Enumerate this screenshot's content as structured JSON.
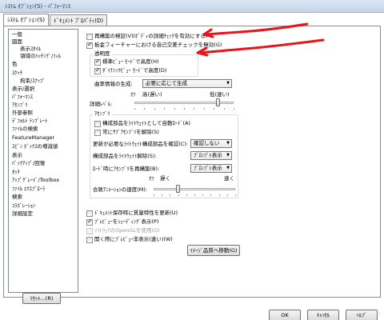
{
  "window": {
    "title": "ｼｽﾃﾑ ｵﾌﾟｼｮﾝ(S) - ﾊﾟﾌｫｰﾏﾝｽ"
  },
  "tabs": [
    {
      "label": "ｼｽﾃﾑ ｵﾌﾟｼｮﾝ(S)"
    },
    {
      "label": "ﾄﾞｷｭﾒﾝﾄ ﾌﾟﾛﾊﾟﾃｨ(D)"
    }
  ],
  "tree": [
    {
      "label": "一般"
    },
    {
      "label": "図面"
    },
    {
      "label": "表示ｽﾀｲﾙ"
    },
    {
      "label": "領域のﾊｯﾁﾝｸﾞ/ﾌｨﾙ"
    },
    {
      "label": "色"
    },
    {
      "label": "ｽｹｯﾁ"
    },
    {
      "label": "拘束/ｽﾅｯﾌﾟ"
    },
    {
      "label": "表示/選択"
    },
    {
      "label": "ﾊﾟﾌｫｰﾏﾝｽ"
    },
    {
      "label": "ｱｾﾝﾌﾞﾘ"
    },
    {
      "label": "外部参照"
    },
    {
      "label": "ﾃﾞﾌｫﾙﾄ ﾃﾝﾌﾟﾚｰﾄ"
    },
    {
      "label": "ﾌｧｲﾙの検索"
    },
    {
      "label": "FeatureManager"
    },
    {
      "label": "ｽﾋﾟﾝ ﾎﾞｯｸｽの増減値"
    },
    {
      "label": "表示"
    },
    {
      "label": "ﾊﾞｯｸｱｯﾌﾟ/回復"
    },
    {
      "label": "ﾀｯﾁ"
    },
    {
      "label": "ｱｯﾌﾟｸﾞﾚｰﾄﾞ/Toolbox"
    },
    {
      "label": "ﾌｧｲﾙ ｴｸｽﾌﾟﾛｰﾗ"
    },
    {
      "label": "検索"
    },
    {
      "label": "ｺﾗﾎﾞﾚｰｼｮﾝ"
    },
    {
      "label": "詳細設定"
    }
  ],
  "reset_button": "ﾘｾｯﾄ...(R)",
  "options": {
    "rebuild_verify": {
      "label": "再構築の検証(V)(ﾎﾞﾃﾞｨの詳細ﾁｪｯｸを有効にする)",
      "checked": false
    },
    "self_intersect": {
      "label": "板金フィーチャーにおける自己交差チェックを無効(G)",
      "checked": true
    },
    "transparency_group": "透明度",
    "std_view_quality": {
      "label": "標準ﾋﾞｭｰ ﾓｰﾄﾞで高度(H)",
      "checked": true
    },
    "dyn_view_quality": {
      "label": "ﾀﾞｲﾅﾐｯｸﾋﾞｭｰ ﾓｰﾄﾞで高度(D)",
      "checked": true
    },
    "curvature_label": "曲率情報の生成:",
    "curvature_value": "必要に応じて生成",
    "detail_low_label": "ｵﾌ",
    "detail_high_label": "高(遅い)",
    "detail_fast_label": "低(速い)",
    "detail_level_label": "詳細ﾚﾍﾞﾙ:",
    "detail_level": 0.85,
    "assembly_group": "ｱｾﾝﾌﾞﾘ",
    "auto_load_light": {
      "label": "構成部品をﾗｲﾄｳｪｲﾄとして自動ﾛｰﾄﾞ(A)",
      "checked": false
    },
    "always_resolve_sub": {
      "label": "常にｻﾌﾞｱｾﾝﾌﾞﾘを解除(S)",
      "checked": false
    },
    "check_outdated_label": "更新が必要なﾗｲﾄｳｪｲﾄ構成部品を確認(C):",
    "check_outdated_value": "確認しない",
    "resolve_light_label": "構成部品をﾗｲﾄｳｪｲﾄ解除(S):",
    "resolve_light_value": "ﾌﾟﾛﾝﾌﾟﾄ表示",
    "rebuild_on_load_label": "ﾛｰﾄﾞ時にｱｾﾝﾌﾞﾘを再構築(B):",
    "rebuild_on_load_value": "ﾌﾟﾛﾝﾌﾟﾄ表示",
    "anim_off": "ｵﾌ",
    "anim_slow": "遅く",
    "anim_fast": "速く",
    "anim_speed_label": "合致ｱﾆﾒｰｼｮﾝの速度(M):",
    "anim_speed": 0.3,
    "update_mass": {
      "label": "ﾄﾞｷｭﾒﾝﾄ保存時に質量特性を更新(U)",
      "checked": false
    },
    "preview_shading": {
      "label": "ﾌﾟﾚﾋﾞｭｰをｼｪｰﾃﾞｨﾝｸﾞ表示(P)",
      "checked": true
    },
    "software_opengl": {
      "label": "ｿﾌﾄｳｪｱのOpenGLを使用(O)",
      "checked": false,
      "disabled": true
    },
    "no_preview_open": {
      "label": "開く際にﾌﾟﾚﾋﾞｭｰ非表示(速い)(W)",
      "checked": false
    },
    "image_quality_button": "ｲﾒｰｼﾞ品質へ移動(G)"
  },
  "footer": {
    "ok": "OK",
    "cancel": "ｷｬﾝｾﾙ",
    "help": "ﾍﾙﾌﾟ"
  },
  "colors": {
    "annotation": "#e8131b",
    "titlebar": "#c4d5ea"
  }
}
